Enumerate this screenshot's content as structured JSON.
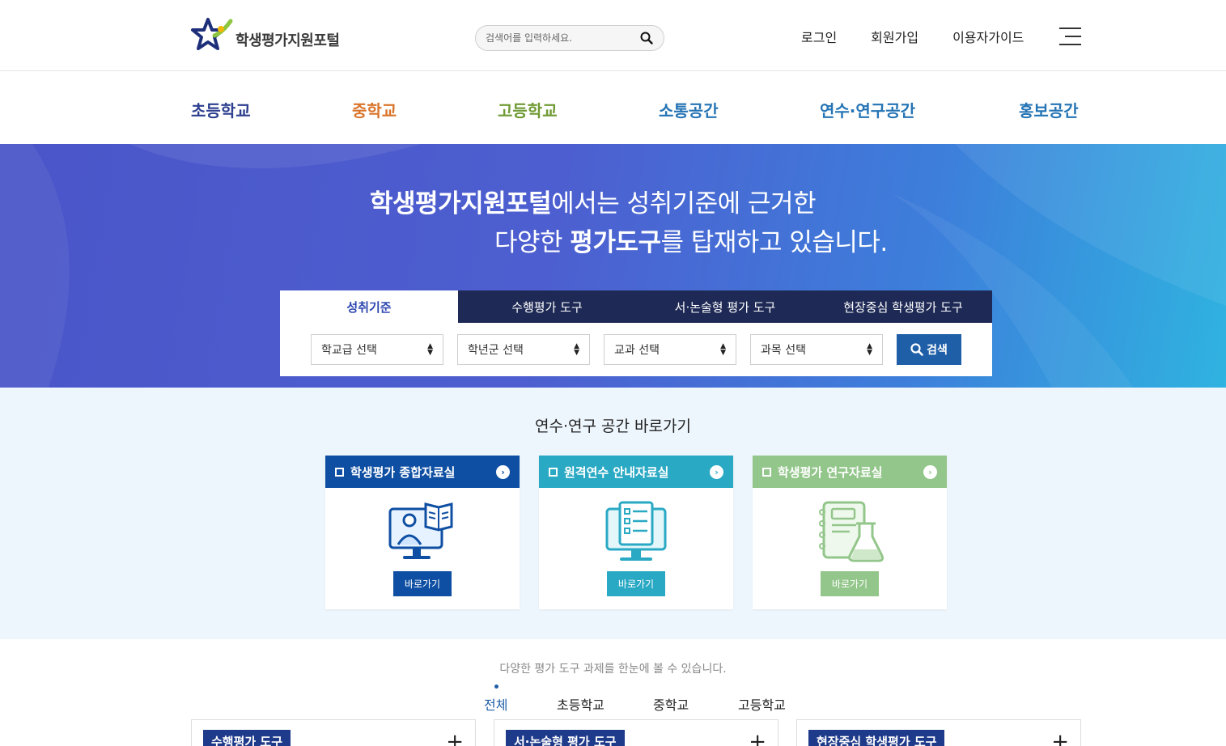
{
  "header": {
    "logo_text": "학생평가지원포털",
    "search_placeholder": "검색어를 입력하세요.",
    "links": [
      "로그인",
      "회원가입",
      "이용자가이드"
    ]
  },
  "nav": {
    "items": [
      {
        "label": "초등학교",
        "color": "#2d3f8f"
      },
      {
        "label": "중학교",
        "color": "#d9742a"
      },
      {
        "label": "고등학교",
        "color": "#6f9a33"
      },
      {
        "label": "소통공간",
        "color": "#2574b5"
      },
      {
        "label": "연수·연구공간",
        "color": "#2574b5"
      },
      {
        "label": "홍보공간",
        "color": "#2574b5"
      }
    ]
  },
  "hero": {
    "line1_bold": "학생평가지원포털",
    "line1_rest": "에서는 성취기준에 근거한",
    "line2_pre": "다양한 ",
    "line2_bold": "평가도구",
    "line2_rest": "를 탑재하고 있습니다."
  },
  "search_panel": {
    "tabs": [
      "성취기준",
      "수행평가 도구",
      "서·논술형 평가 도구",
      "현장중심 학생평가 도구"
    ],
    "active_tab": 0,
    "selects": [
      "학교급 선택",
      "학년군 선택",
      "교과 선택",
      "과목 선택"
    ],
    "button_label": "검색"
  },
  "shortcuts": {
    "title": "연수·연구 공간 바로가기",
    "cards": [
      {
        "title": "학생평가 종합자료실",
        "button": "바로가기",
        "color": "#0f4fa3",
        "icon": "teacher-monitor-book-icon"
      },
      {
        "title": "원격연수 안내자료실",
        "button": "바로가기",
        "color": "#2aa9c4",
        "icon": "monitor-checklist-icon"
      },
      {
        "title": "학생평가 연구자료실",
        "button": "바로가기",
        "color": "#93c68a",
        "icon": "notebook-flask-icon"
      }
    ]
  },
  "tools": {
    "subtitle": "다양한 평가 도구 과제를 한눈에 볼 수 있습니다.",
    "filter_tabs": [
      "전체",
      "초등학교",
      "중학교",
      "고등학교"
    ],
    "active_filter": 0,
    "boxes": [
      "수행평가 도구",
      "서·논술형 평가 도구",
      "현장중심 학생평가 도구"
    ]
  }
}
